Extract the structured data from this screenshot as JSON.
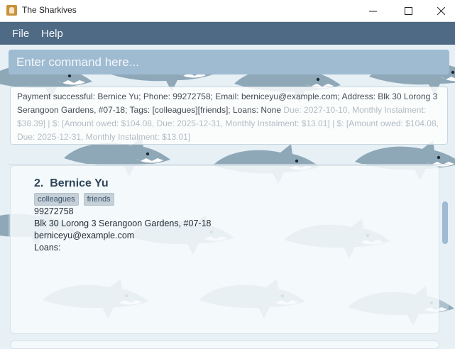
{
  "window": {
    "title": "The Sharkives",
    "app_icon": "app-icon",
    "controls": {
      "minimize_icon": "minimize-icon",
      "maximize_icon": "maximize-icon",
      "close_icon": "close-icon"
    }
  },
  "menu": {
    "file": "File",
    "help": "Help"
  },
  "command": {
    "placeholder": "Enter command here..."
  },
  "result": {
    "text": "Payment successful: Bernice Yu; Phone: 99272758; Email: berniceyu@example.com; Address: Blk 30 Lorong 3 Serangoon Gardens, #07-18; Tags: [colleagues][friends]; Loans: None",
    "faded": "Due: 2027-10-10, Monthly Instalment: $38.39] | $: [Amount owed: $104.08, Due: 2025-12-31, Monthly Instalment: $13.01] | $: [Amount owed: $104.08, Due: 2025-12-31, Monthly Instalment: $13.01]"
  },
  "person": {
    "index": "2.",
    "name": "Bernice Yu",
    "tags": [
      "colleagues",
      "friends"
    ],
    "phone": "99272758",
    "address": "Blk 30 Lorong 3 Serangoon Gardens, #07-18",
    "email": "berniceyu@example.com",
    "loans": "Loans:"
  },
  "colors": {
    "menubar": "#4e6a85",
    "command_box": "#9fbbd2",
    "tag_bg": "#c5d0d8",
    "scroll_thumb": "#9fbbd2"
  }
}
